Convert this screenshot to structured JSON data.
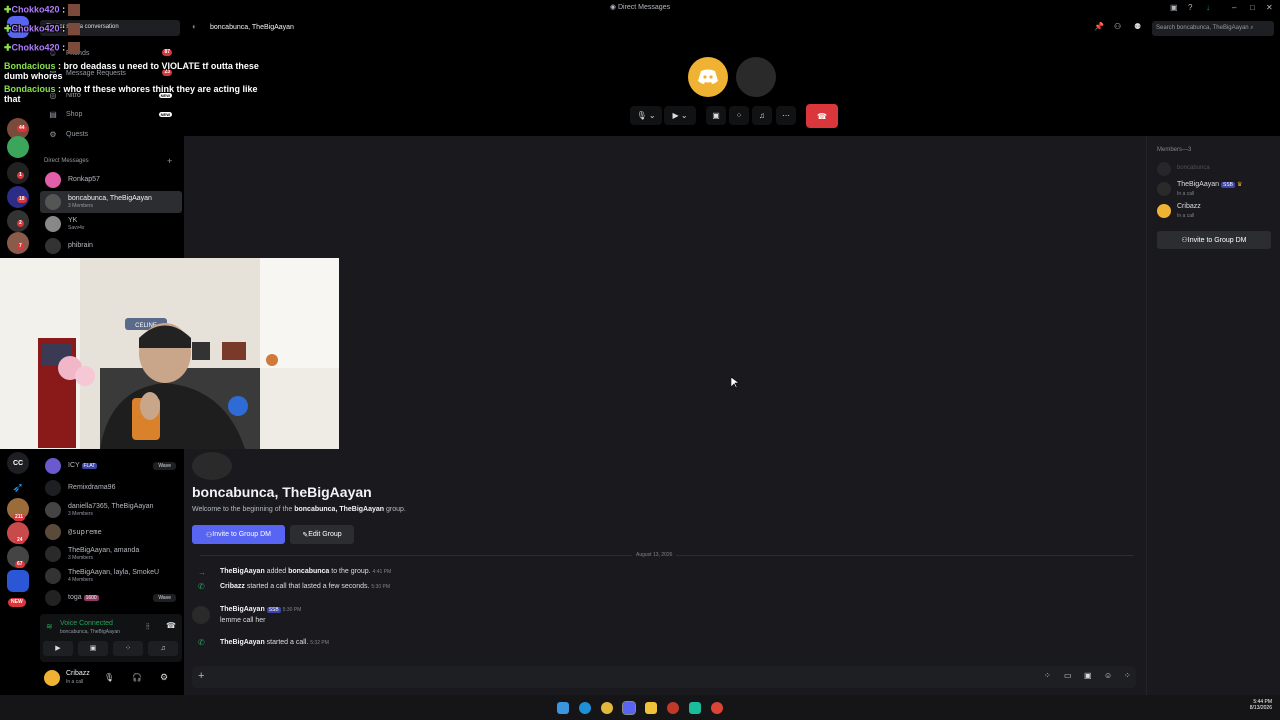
{
  "window": {
    "title": "Direct Messages"
  },
  "overlay_chat": [
    {
      "user": "Chokko420",
      "sep": " :",
      "text": "",
      "color": "purple"
    },
    {
      "user": "Chokko420",
      "sep": " :",
      "text": "",
      "color": "purple"
    },
    {
      "user": "Chokko420",
      "sep": " :",
      "text": "",
      "color": "purple"
    },
    {
      "user": "Bondacious",
      "sep": " :",
      "text": " bro deadass u need to VIOLATE tf outta these",
      "cont": "dumb whores",
      "color": "green"
    },
    {
      "user": "Bondacious",
      "sep": " :",
      "text": " who tf these whores think they are acting like",
      "cont": "that",
      "color": "green"
    }
  ],
  "sidebar": {
    "start_conversation": "Find or start a conversation",
    "friends_label": "Friends",
    "message_requests_label": "Message Requests",
    "nitro_label": "Nitro",
    "shop_label": "Shop",
    "quests_label": "Quests",
    "new_badge": "NEW",
    "friends_badge": "87",
    "requests_badge": "23",
    "direct_messages_label": "Direct Messages",
    "add_dm": "+",
    "dms_top": [
      {
        "name": "Ronkap57",
        "sub": ""
      },
      {
        "name": "boncabunca, TheBigAayan",
        "sub": "3 Members"
      },
      {
        "name": "YK",
        "sub": "Savv4x"
      },
      {
        "name": "phibrain",
        "sub": ""
      }
    ],
    "dms_bottom": [
      {
        "name": "ICY",
        "tag": "FLAT",
        "sub": "",
        "wave": "Wave"
      },
      {
        "name": "Remixdrama96",
        "sub": ""
      },
      {
        "name": "daniella7365, TheBigAayan",
        "sub": "3 Members"
      },
      {
        "name": "@supreme",
        "sub": ""
      },
      {
        "name": "TheBigAayan, amanda",
        "sub": "3 Members"
      },
      {
        "name": "TheBigAayan, layla, SmokeU",
        "sub": "4 Members"
      },
      {
        "name": "toga",
        "tag": "1600",
        "sub": "",
        "wave": "Wave"
      }
    ],
    "voice": {
      "status": "Voice Connected",
      "channel": "boncabunca, TheBigAayan"
    },
    "user": {
      "name": "Cribazz",
      "status": "In a call"
    }
  },
  "rail_badges": [
    "44",
    "1",
    "18",
    "2",
    "7",
    "211",
    "24",
    "67",
    "NEW"
  ],
  "header": {
    "channel": "boncabunca, TheBigAayan",
    "search_placeholder": "Search boncabunca, TheBigAayan"
  },
  "main": {
    "group_title": "boncabunca, TheBigAayan",
    "welcome_pre": "Welcome to the beginning of the ",
    "welcome_bold": "boncabunca, TheBigAayan",
    "welcome_post": " group.",
    "invite_label": "Invite to Group DM",
    "edit_label": "Edit Group",
    "date_divider": "August 13, 2026",
    "system_1": {
      "actor": "TheBigAayan",
      "verb": " added ",
      "target": "boncabunca",
      "rest": " to the group.",
      "time": "4:41 PM"
    },
    "system_2": {
      "actor": "Cribazz",
      "rest": " started a call that lasted a few seconds.",
      "time": "5:30 PM"
    },
    "message": {
      "author": "TheBigAayan",
      "tag": "SSB",
      "time": "5:30 PM",
      "text": "lemme call her"
    },
    "system_3": {
      "actor": "TheBigAayan",
      "rest": " started a call.",
      "time": "5:32 PM"
    }
  },
  "members": {
    "heading": "Members—3",
    "list": [
      {
        "name": "boncabunca",
        "status": ""
      },
      {
        "name": "TheBigAayan",
        "tag": "SSB",
        "status": "In a call"
      },
      {
        "name": "Cribazz",
        "status": "In a call"
      }
    ],
    "invite_label": "Invite to Group DM"
  },
  "webcam": {
    "sign": "CELINE"
  },
  "clock": {
    "time": "5:44 PM",
    "date": "8/13/2026"
  },
  "colors": {
    "blurple": "#5865f2",
    "danger": "#da373c",
    "green": "#23a55a"
  }
}
